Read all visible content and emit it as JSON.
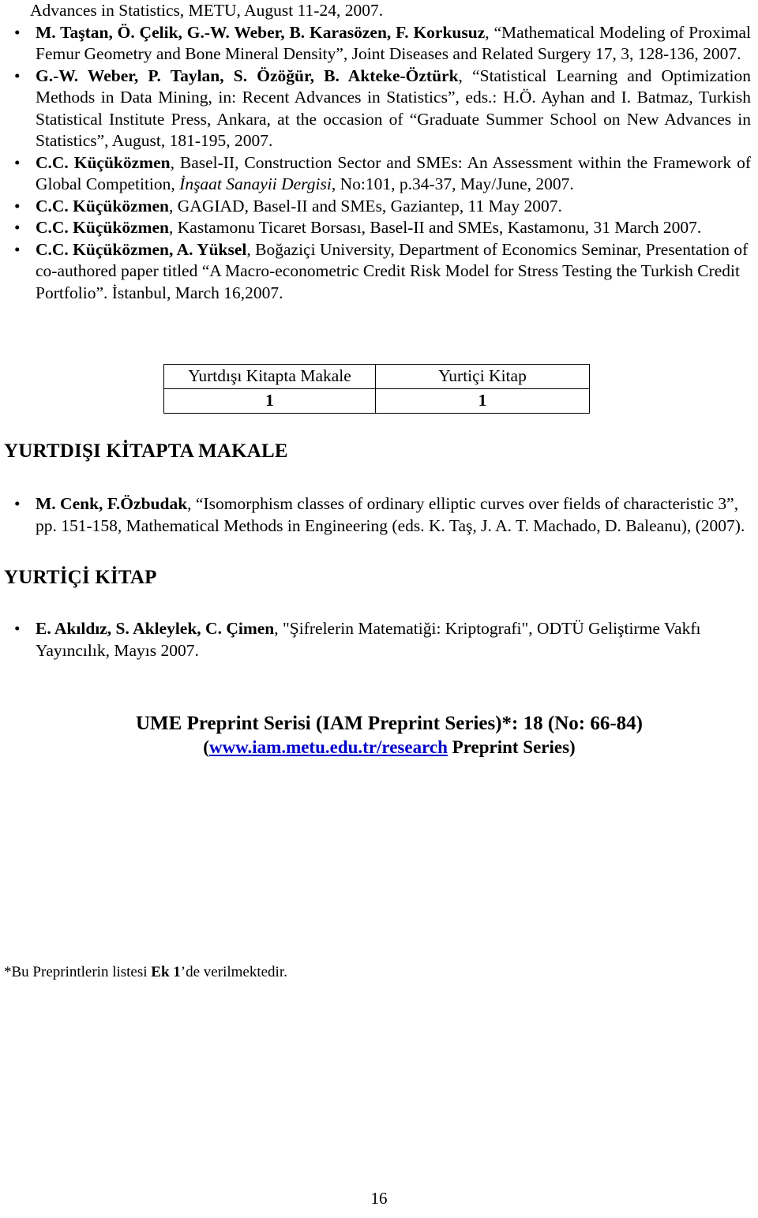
{
  "document": {
    "page_number": "16",
    "link_color": "#0000CC"
  },
  "references_continued": {
    "first_line_continuation": "Advances in Statistics, METU, August 11-24, 2007.",
    "items": [
      {
        "bullet": "•",
        "authors": "M. Taştan, Ö. Çelik, G.-W. Weber, B. Karasözen, F. Korkusuz",
        "rest": ", “Mathematical Modeling of Proximal Femur Geometry and Bone Mineral Density”, Joint Diseases and Related Surgery 17, 3, 128-136, 2007."
      },
      {
        "bullet": "•",
        "authors": "G.-W. Weber, P. Taylan, S. Özöğür, B. Akteke-Öztürk",
        "rest": ", “Statistical Learning and Optimization Methods in Data Mining, in: Recent Advances in Statistics”, eds.: H.Ö. Ayhan and I. Batmaz, Turkish Statistical Institute Press, Ankara, at the occasion of “Graduate Summer School on New Advances in Statistics”, August, 181-195, 2007."
      },
      {
        "bullet": "•",
        "authors": "C.C. Küçüközmen",
        "rest_before_italic": ", Basel-II, Construction Sector and SMEs: An Assessment within the Framework of Global Competition, ",
        "italic": "İnşaat Sanayii Dergisi",
        "rest_after_italic": ", No:101, p.34-37, May/June, 2007."
      },
      {
        "bullet": "•",
        "authors": "C.C. Küçüközmen",
        "rest": ", GAGIAD, Basel-II and SMEs, Gaziantep, 11 May 2007."
      },
      {
        "bullet": "•",
        "authors": "C.C. Küçüközmen",
        "rest": ", Kastamonu Ticaret Borsası, Basel-II and SMEs, Kastamonu, 31 March 2007."
      },
      {
        "bullet": "•",
        "authors": "C.C. Küçüközmen",
        "authors_mid": ", A. Yüksel",
        "rest": ", Boğaziçi University, Department of Economics Seminar, Presentation of co-authored paper titled “A Macro-econometric Credit Risk Model for Stress Testing the Turkish Credit Portfolio”. İstanbul, March 16,2007."
      }
    ]
  },
  "counts_table": {
    "headers": [
      "Yurtdışı Kitapta Makale",
      "Yurtiçi Kitap"
    ],
    "values": [
      "1",
      "1"
    ]
  },
  "sections": [
    {
      "heading": "YURTDIŞI KİTAPTA MAKALE",
      "items": [
        {
          "bullet": "•",
          "authors": "M. Cenk, F.Özbudak",
          "rest": ", “Isomorphism classes of ordinary elliptic curves over fields of characteristic 3”, pp. 151-158, Mathematical Methods in Engineering (eds. K. Taş, J. A. T. Machado, D. Baleanu), (2007)."
        }
      ]
    },
    {
      "heading": "YURTİÇİ KİTAP",
      "items": [
        {
          "bullet": "•",
          "authors": "E. Akıldız, S. Akleylek, C. Çimen",
          "rest": ", \"Şifrelerin Matematiği: Kriptografi\", ODTÜ Geliştirme Vakfı Yayıncılık, Mayıs 2007."
        }
      ]
    }
  ],
  "preprint": {
    "title_main": "UME Preprint  Serisi (IAM Preprint Series)*: 18 (No: 66-84",
    "title_tail": ")",
    "sub_open": "(",
    "url_text": "www.iam.metu.edu.tr/research",
    "sub_tail": " Preprint Series)"
  },
  "footnote": {
    "prefix": "*Bu Preprintlerin listesi ",
    "bold": "Ek 1",
    "suffix": "’de verilmektedir."
  }
}
